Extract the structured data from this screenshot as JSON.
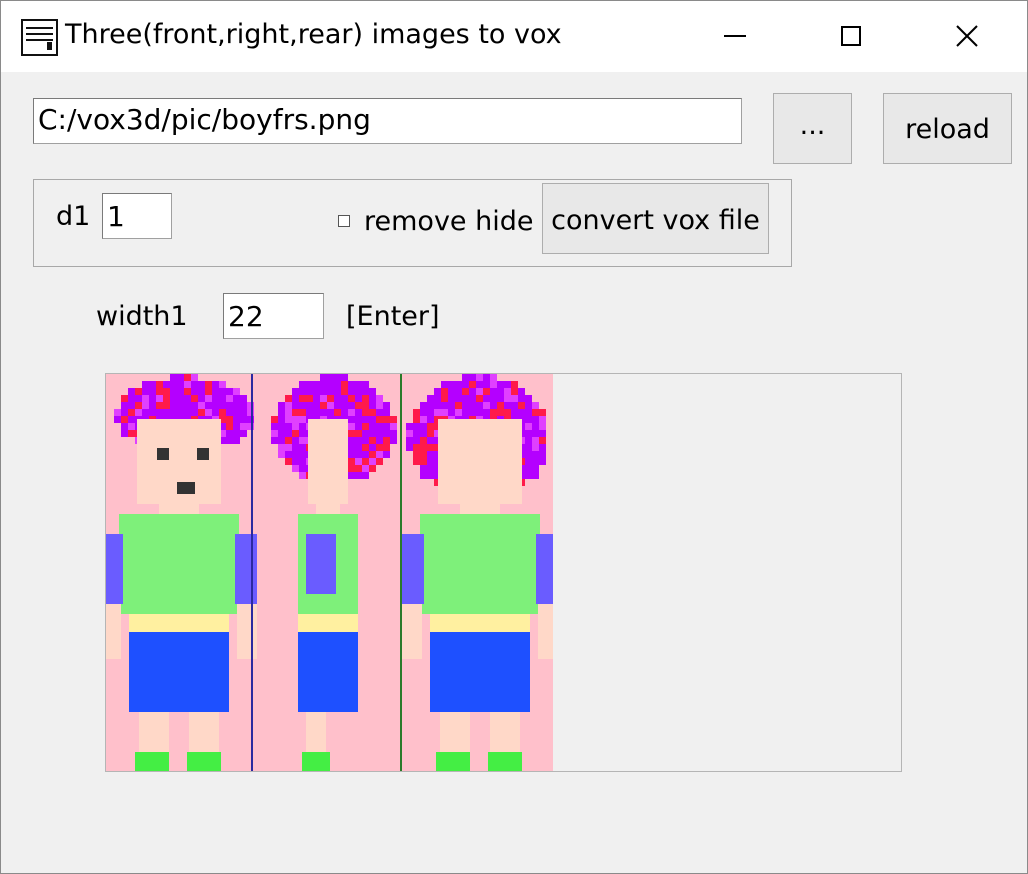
{
  "window": {
    "title": "Three(front,right,rear) images to vox",
    "icon": "crazy-small-app-icon",
    "controls": [
      "minimize-icon",
      "maximize-icon",
      "close-icon"
    ]
  },
  "file": {
    "path_value": "C:/vox3d/pic/boyfrs.png",
    "browse_label": "...",
    "reload_label": "reload"
  },
  "options": {
    "d1_label": "d1",
    "d1_value": "1",
    "remove_hide_label": "remove hide",
    "remove_hide_checked": false,
    "convert_label": "convert vox file"
  },
  "width": {
    "label": "width1",
    "value": "22",
    "hint": "[Enter]"
  },
  "preview": {
    "views": [
      "front",
      "right",
      "rear"
    ],
    "divider_colors": [
      "#2a2aa0",
      "#2a7a2a"
    ],
    "palette": {
      "background": "#ffc0cb",
      "skin": "#ffd8c8",
      "hair": "#b400ff",
      "hair_accent": "#ff1a4a",
      "shirt": "#7ef07a",
      "sleeve": "#6a5cff",
      "belt": "#fff0a0",
      "shorts": "#1e50ff",
      "shoes": "#44ee44",
      "eyes": "#333333"
    }
  }
}
